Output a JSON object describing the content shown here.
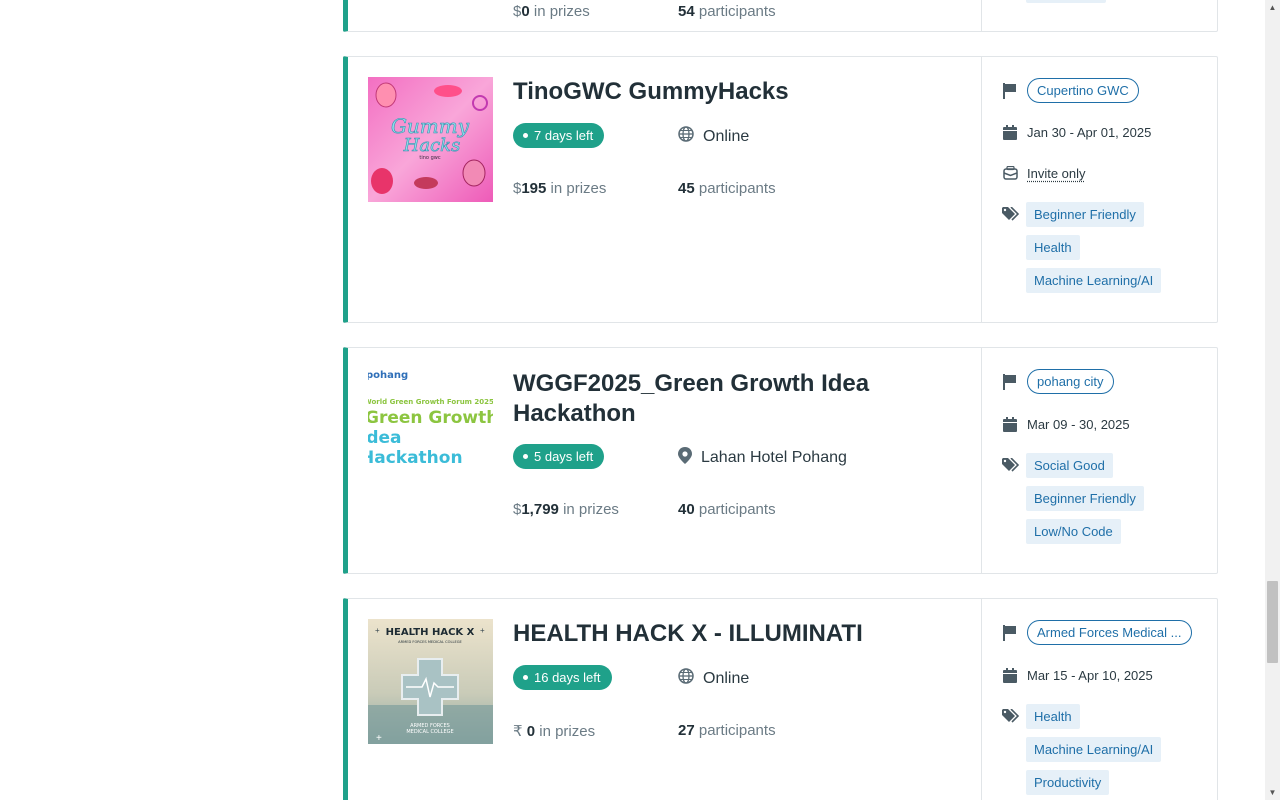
{
  "previous_card": {
    "prize_symbol": "$",
    "prize_amount": "0",
    "prize_suffix": "in prizes",
    "participants_count": "54",
    "participants_label": "participants"
  },
  "hackathons": [
    {
      "title": "TinoGWC GummyHacks",
      "days_left": "7 days left",
      "location": "Online",
      "location_icon": "globe-icon",
      "prize_symbol": "$",
      "prize_amount": "195",
      "prize_suffix": "in prizes",
      "participants_count": "45",
      "participants_label": "participants",
      "host": "Cupertino GWC",
      "dates": "Jan 30 - Apr 01, 2025",
      "access": "Invite only",
      "tags": [
        "Beginner Friendly",
        "Health",
        "Machine Learning/AI"
      ],
      "thumbnail_text": {
        "line1": "Gummy",
        "line2": "Hacks",
        "line3": "tino gwc"
      }
    },
    {
      "title": "WGGF2025_Green Growth Idea Hackathon",
      "days_left": "5 days left",
      "location": "Lahan Hotel Pohang",
      "location_icon": "map-pin-icon",
      "prize_symbol": "$",
      "prize_amount": "1,799",
      "prize_suffix": "in prizes",
      "participants_count": "40",
      "participants_label": "participants",
      "host": "pohang city",
      "dates": "Mar 09 - 30, 2025",
      "tags": [
        "Social Good",
        "Beginner Friendly",
        "Low/No Code"
      ],
      "thumbnail_text": {
        "logo": "pohang",
        "forum": "World Green Growth Forum 2025",
        "line1": "Green Growth",
        "line2": "Idea",
        "line3": "Hackathon"
      }
    },
    {
      "title": "HEALTH HACK X - ILLUMINATI",
      "days_left": "16 days left",
      "location": "Online",
      "location_icon": "globe-icon",
      "prize_symbol": "₹",
      "prize_amount": "0",
      "prize_suffix": "in prizes",
      "participants_count": "27",
      "participants_label": "participants",
      "host": "Armed Forces Medical ...",
      "dates": "Mar 15 - Apr 10, 2025",
      "tags": [
        "Health",
        "Machine Learning/AI",
        "Productivity"
      ],
      "thumbnail_text": {
        "line1": "HEALTH HACK X",
        "line2": "ARMED FORCES MEDICAL COLLEGE",
        "line3": "ARMED FORCES",
        "line4": "MEDICAL COLLEGE"
      }
    }
  ],
  "colors": {
    "accent": "#1fa18a",
    "link": "#1f6fa8",
    "tag_bg": "#e6f0f8"
  }
}
